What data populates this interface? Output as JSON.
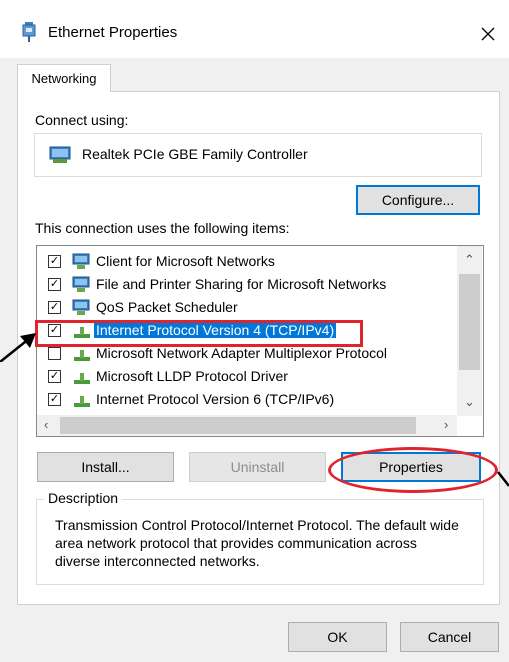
{
  "window": {
    "title": "Ethernet Properties",
    "close_label": "✕"
  },
  "tabs": [
    {
      "label": "Networking"
    }
  ],
  "connect_using": {
    "label": "Connect using:",
    "adapter_name": "Realtek PCIe GBE Family Controller",
    "configure_label": "Configure..."
  },
  "items_section": {
    "label": "This connection uses the following items:",
    "items": [
      {
        "label": "Client for Microsoft Networks",
        "checked": true,
        "icon": "network-client-icon",
        "selected": false
      },
      {
        "label": "File and Printer Sharing for Microsoft Networks",
        "checked": true,
        "icon": "network-service-icon",
        "selected": false
      },
      {
        "label": "QoS Packet Scheduler",
        "checked": true,
        "icon": "network-service-icon",
        "selected": false
      },
      {
        "label": "Internet Protocol Version 4 (TCP/IPv4)",
        "checked": true,
        "icon": "protocol-icon",
        "selected": true
      },
      {
        "label": "Microsoft Network Adapter Multiplexor Protocol",
        "checked": false,
        "icon": "protocol-icon",
        "selected": false
      },
      {
        "label": "Microsoft LLDP Protocol Driver",
        "checked": true,
        "icon": "protocol-icon",
        "selected": false
      },
      {
        "label": "Internet Protocol Version 6 (TCP/IPv6)",
        "checked": true,
        "icon": "protocol-icon",
        "selected": false
      }
    ]
  },
  "buttons": {
    "install": "Install...",
    "uninstall": "Uninstall",
    "properties": "Properties"
  },
  "description": {
    "legend": "Description",
    "text": "Transmission Control Protocol/Internet Protocol. The default wide area network protocol that provides communication across diverse interconnected networks."
  },
  "footer": {
    "ok": "OK",
    "cancel": "Cancel"
  },
  "colors": {
    "accent": "#0078d7",
    "annotation": "#e0242e"
  }
}
